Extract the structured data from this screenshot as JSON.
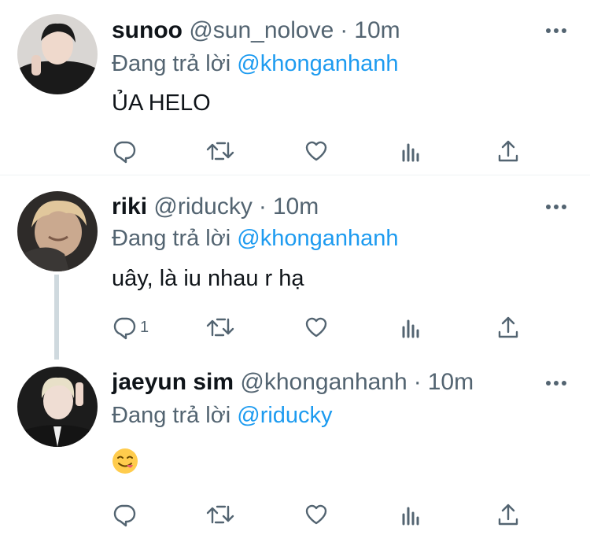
{
  "colors": {
    "link": "#1d9bf0",
    "secondary": "#536471",
    "primary": "#0f1419",
    "divider": "#eff3f4",
    "thread_line": "#cfd9de"
  },
  "icons": {
    "reply": "reply-icon",
    "retweet": "retweet-icon",
    "like": "like-icon",
    "views": "analytics-icon",
    "share": "share-icon",
    "more": "more-icon"
  },
  "tweets": [
    {
      "name": "sunoo",
      "handle": "@sun_nolove",
      "dot": "·",
      "time": "10m",
      "reply_prefix": "Đang trả lời ",
      "reply_to": "@khonganhanh",
      "text": "ỦA HELO",
      "reply_count": ""
    },
    {
      "name": "riki",
      "handle": "@riducky",
      "dot": "·",
      "time": "10m",
      "reply_prefix": "Đang trả lời ",
      "reply_to": "@khonganhanh",
      "text": "uây, là iu nhau r hạ",
      "reply_count": "1"
    },
    {
      "name": "jaeyun sim",
      "handle": "@khonganhanh",
      "dot": "·",
      "time": "10m",
      "reply_prefix": "Đang trả lời ",
      "reply_to": "@riducky",
      "text": "",
      "emoji": "savoring-food-emoji",
      "reply_count": ""
    }
  ]
}
